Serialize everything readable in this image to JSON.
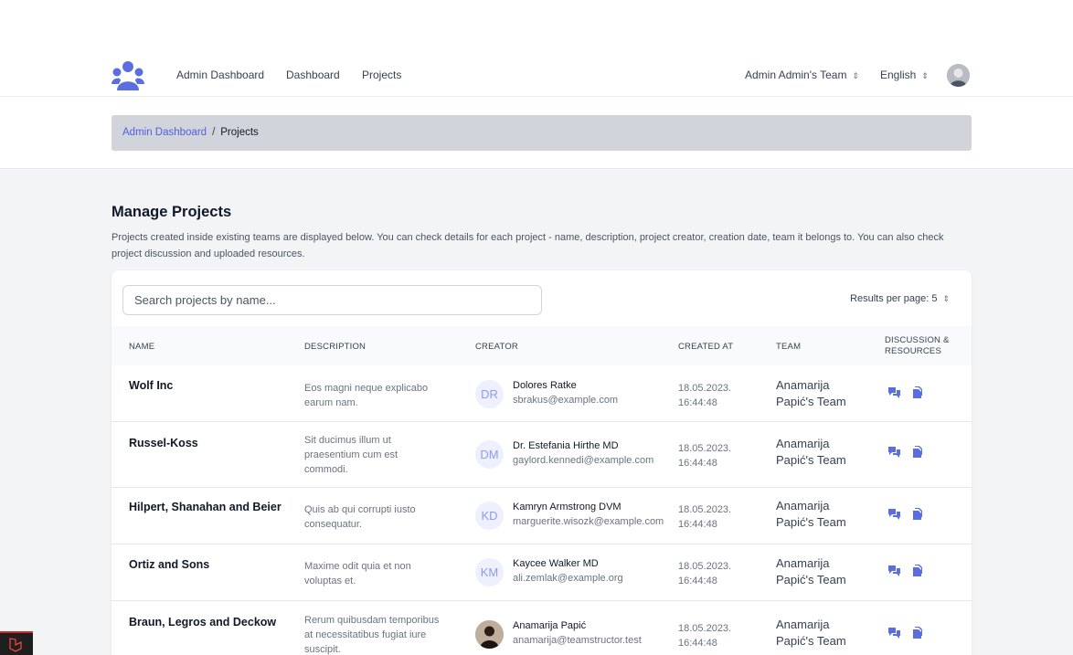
{
  "nav": {
    "links": [
      "Admin Dashboard",
      "Dashboard",
      "Projects"
    ],
    "team_selector": "Admin Admin's Team",
    "language_selector": "English"
  },
  "breadcrumb": {
    "root": "Admin Dashboard",
    "separator": "/",
    "current": "Projects"
  },
  "page": {
    "title": "Manage Projects",
    "description": "Projects created inside existing teams are displayed below. You can check details for each project - name, description, project creator, creation date, team it belongs to. You can also check project discussion and uploaded resources."
  },
  "search": {
    "placeholder": "Search projects by name...",
    "value": ""
  },
  "results_per_page": "Results per page: 5",
  "table": {
    "headers": [
      "NAME",
      "DESCRIPTION",
      "CREATOR",
      "CREATED AT",
      "TEAM",
      "DISCUSSION & RESOURCES"
    ],
    "rows": [
      {
        "name": "Wolf Inc",
        "description": "Eos magni neque explicabo earum nam.",
        "initials": "DR",
        "creator": "Dolores Ratke",
        "email": "sbrakus@example.com",
        "date": "18.05.2023.",
        "time": "16:44:48",
        "team": "Anamarija Papić's Team"
      },
      {
        "name": "Russel-Koss",
        "description": "Sit ducimus illum ut praesentium cum est commodi.",
        "initials": "DM",
        "creator": "Dr. Estefania Hirthe MD",
        "email": "gaylord.kennedi@example.com",
        "date": "18.05.2023.",
        "time": "16:44:48",
        "team": "Anamarija Papić's Team"
      },
      {
        "name": "Hilpert, Shanahan and Beier",
        "description": "Quis ab qui corrupti iusto consequatur.",
        "initials": "KD",
        "creator": "Kamryn Armstrong DVM",
        "email": "marguerite.wisozk@example.com",
        "date": "18.05.2023.",
        "time": "16:44:48",
        "team": "Anamarija Papić's Team"
      },
      {
        "name": "Ortiz and Sons",
        "description": "Maxime odit quia et non voluptas et.",
        "initials": "KM",
        "creator": "Kaycee Walker MD",
        "email": "ali.zemlak@example.org",
        "date": "18.05.2023.",
        "time": "16:44:48",
        "team": "Anamarija Papić's Team"
      },
      {
        "name": "Braun, Legros and Deckow",
        "description": "Rerum quibusdam temporibus at necessitatibus fugiat iure suscipit.",
        "initials": "",
        "creator": "Anamarija Papić",
        "email": "anamarija@teamstructor.test",
        "date": "18.05.2023.",
        "time": "16:44:48",
        "team": "Anamarija Papić's Team"
      }
    ]
  },
  "colors": {
    "accent": "#5b6ee1",
    "link": "#4f5fe0",
    "breadcrumb_bg": "#d1d5db"
  },
  "icons": [
    "team-logo-icon",
    "chevron-updown-icon",
    "user-avatar",
    "discussion-icon",
    "resources-icon",
    "laravel-icon"
  ]
}
